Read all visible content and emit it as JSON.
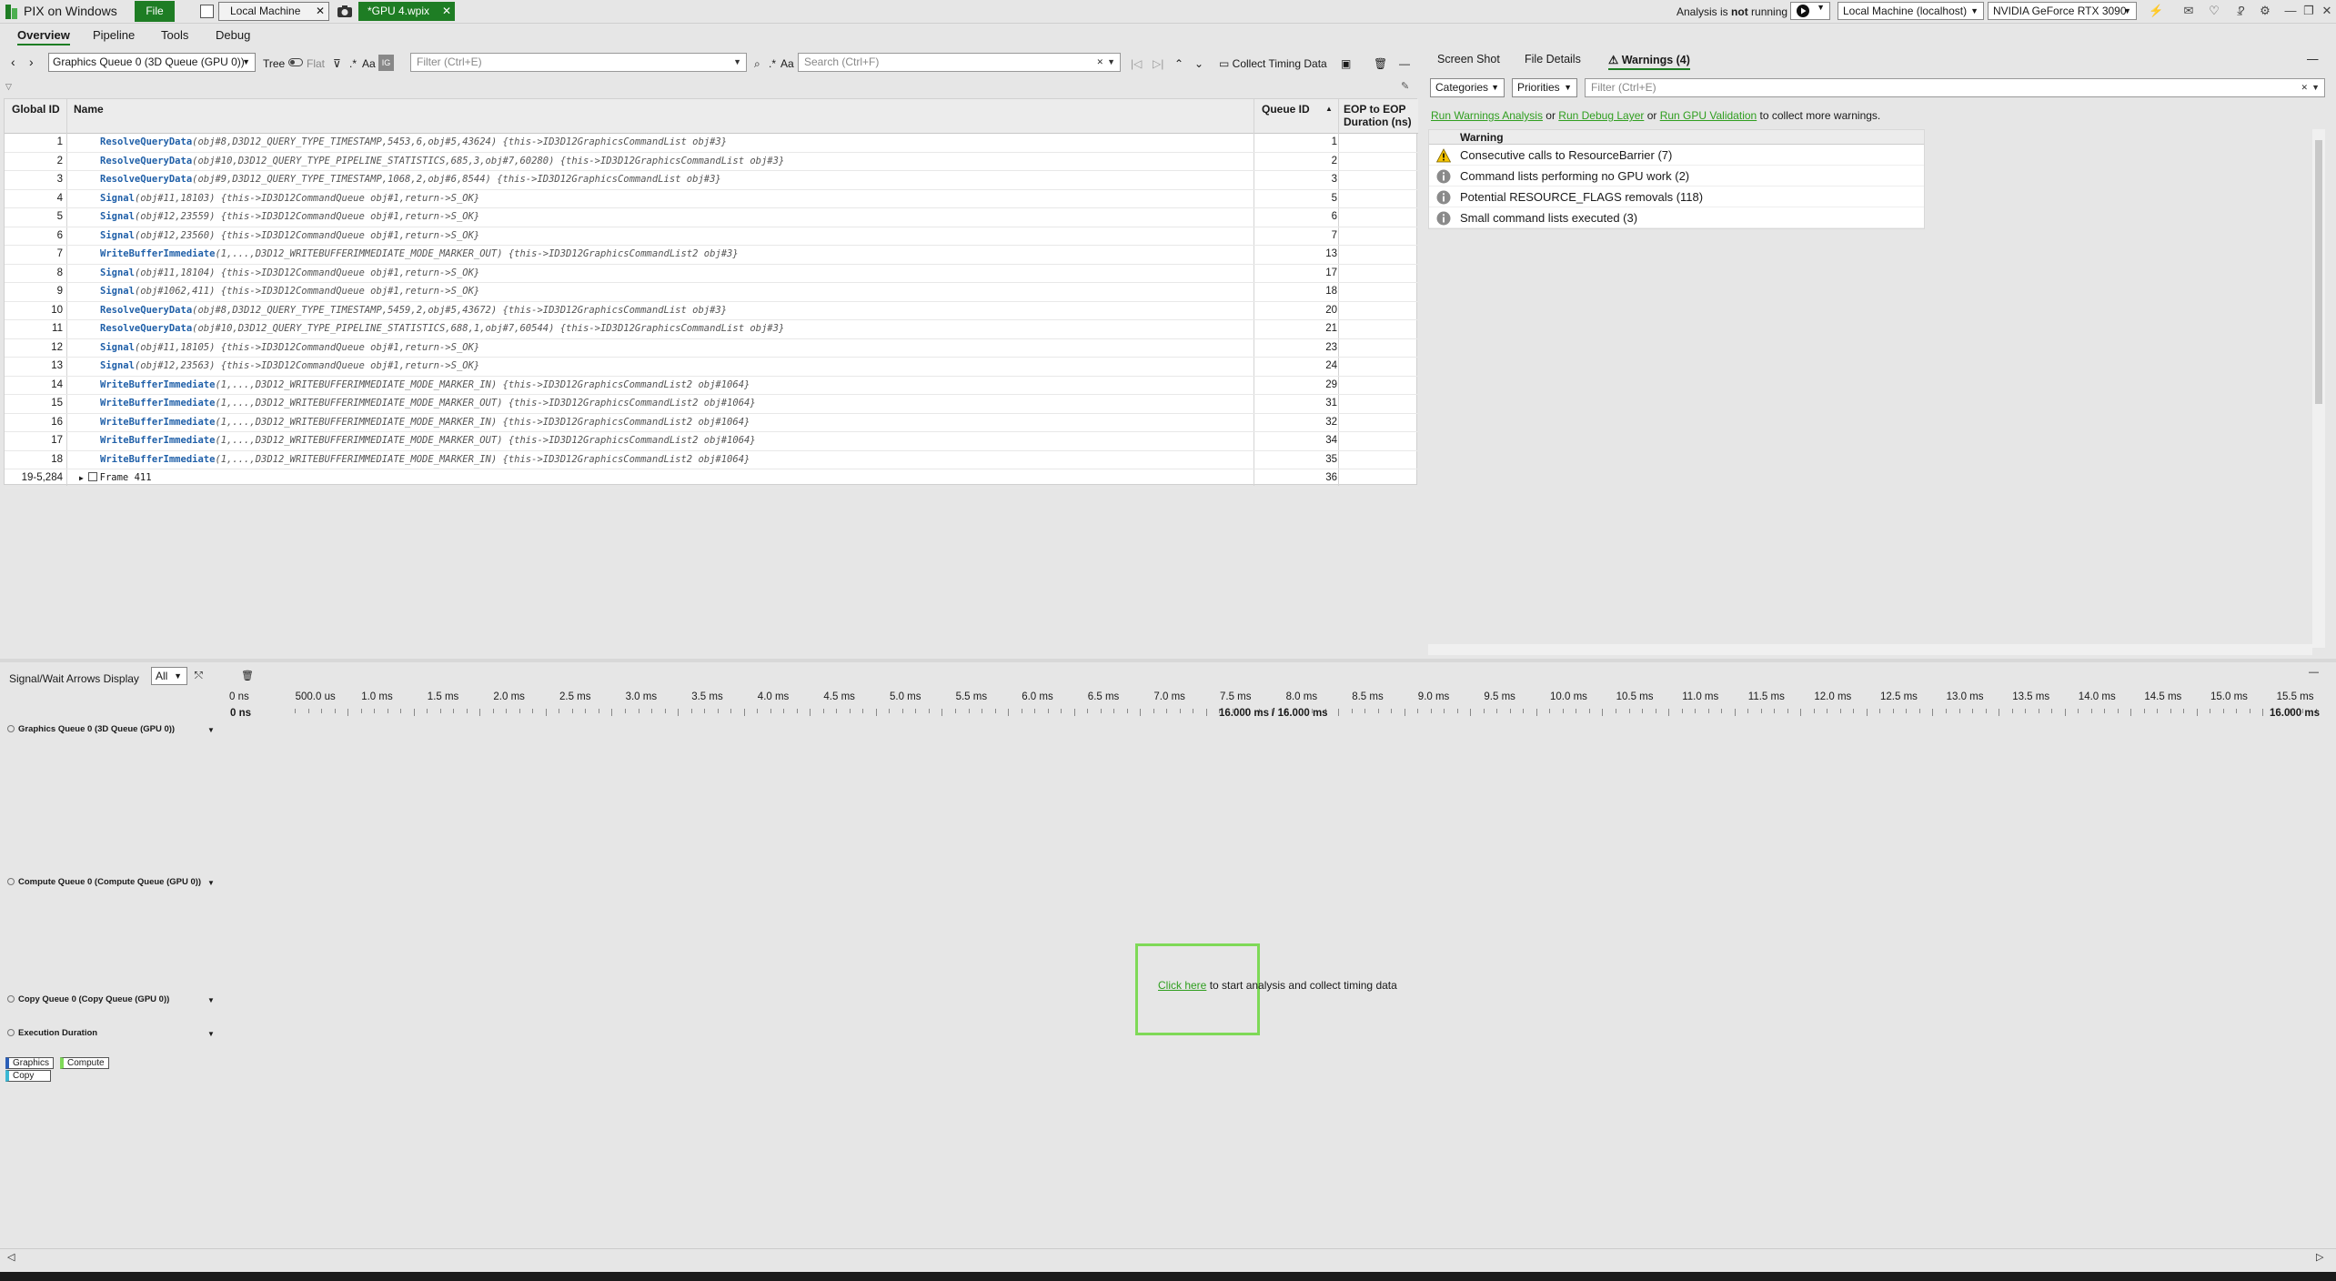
{
  "titlebar": {
    "app_title": "PIX on Windows",
    "file_label": "File",
    "tab_local": "Local Machine",
    "tab_gpu": "*GPU 4.wpix",
    "close_glyph": "✕",
    "analysis_prefix": "Analysis is ",
    "analysis_bold": "not",
    "analysis_suffix": " running",
    "machine": "Local Machine (localhost)",
    "gpu": "NVIDIA GeForce RTX 3090",
    "help": "?"
  },
  "menu": {
    "overview": "Overview",
    "pipeline": "Pipeline",
    "tools": "Tools",
    "debug": "Debug"
  },
  "toolbar": {
    "queue": "Graphics Queue 0 (3D Queue (GPU 0))",
    "tree": "Tree",
    "flat": "Flat",
    "aa": "Aa",
    "filter_placeholder": "Filter (Ctrl+E)",
    "search_placeholder": "Search (Ctrl+F)",
    "collect": "Collect Timing Data"
  },
  "table": {
    "headers": {
      "gid": "Global ID",
      "name": "Name",
      "qid": "Queue ID",
      "eop1": "EOP to EOP",
      "eop2": "Duration (ns)"
    },
    "rows": [
      {
        "gid": "1",
        "fn": "ResolveQueryData",
        "args": "(obj#8,D3D12_QUERY_TYPE_TIMESTAMP,5453,6,obj#5,43624)  {this->ID3D12GraphicsCommandList obj#3}",
        "qid": "1"
      },
      {
        "gid": "2",
        "fn": "ResolveQueryData",
        "args": "(obj#10,D3D12_QUERY_TYPE_PIPELINE_STATISTICS,685,3,obj#7,60280)  {this->ID3D12GraphicsCommandList obj#3}",
        "qid": "2"
      },
      {
        "gid": "3",
        "fn": "ResolveQueryData",
        "args": "(obj#9,D3D12_QUERY_TYPE_TIMESTAMP,1068,2,obj#6,8544)  {this->ID3D12GraphicsCommandList obj#3}",
        "qid": "3"
      },
      {
        "gid": "4",
        "fn": "Signal",
        "args": "(obj#11,18103)  {this->ID3D12CommandQueue obj#1,return->S_OK}",
        "qid": "5"
      },
      {
        "gid": "5",
        "fn": "Signal",
        "args": "(obj#12,23559)  {this->ID3D12CommandQueue obj#1,return->S_OK}",
        "qid": "6"
      },
      {
        "gid": "6",
        "fn": "Signal",
        "args": "(obj#12,23560)  {this->ID3D12CommandQueue obj#1,return->S_OK}",
        "qid": "7"
      },
      {
        "gid": "7",
        "fn": "WriteBufferImmediate",
        "args": "(1,...,D3D12_WRITEBUFFERIMMEDIATE_MODE_MARKER_OUT)  {this->ID3D12GraphicsCommandList2 obj#3}",
        "qid": "13"
      },
      {
        "gid": "8",
        "fn": "Signal",
        "args": "(obj#11,18104)  {this->ID3D12CommandQueue obj#1,return->S_OK}",
        "qid": "17"
      },
      {
        "gid": "9",
        "fn": "Signal",
        "args": "(obj#1062,411)  {this->ID3D12CommandQueue obj#1,return->S_OK}",
        "qid": "18"
      },
      {
        "gid": "10",
        "fn": "ResolveQueryData",
        "args": "(obj#8,D3D12_QUERY_TYPE_TIMESTAMP,5459,2,obj#5,43672)  {this->ID3D12GraphicsCommandList obj#3}",
        "qid": "20"
      },
      {
        "gid": "11",
        "fn": "ResolveQueryData",
        "args": "(obj#10,D3D12_QUERY_TYPE_PIPELINE_STATISTICS,688,1,obj#7,60544)  {this->ID3D12GraphicsCommandList obj#3}",
        "qid": "21"
      },
      {
        "gid": "12",
        "fn": "Signal",
        "args": "(obj#11,18105)  {this->ID3D12CommandQueue obj#1,return->S_OK}",
        "qid": "23"
      },
      {
        "gid": "13",
        "fn": "Signal",
        "args": "(obj#12,23563)  {this->ID3D12CommandQueue obj#1,return->S_OK}",
        "qid": "24"
      },
      {
        "gid": "14",
        "fn": "WriteBufferImmediate",
        "args": "(1,...,D3D12_WRITEBUFFERIMMEDIATE_MODE_MARKER_IN)  {this->ID3D12GraphicsCommandList2 obj#1064}",
        "qid": "29"
      },
      {
        "gid": "15",
        "fn": "WriteBufferImmediate",
        "args": "(1,...,D3D12_WRITEBUFFERIMMEDIATE_MODE_MARKER_OUT)  {this->ID3D12GraphicsCommandList2 obj#1064}",
        "qid": "31"
      },
      {
        "gid": "16",
        "fn": "WriteBufferImmediate",
        "args": "(1,...,D3D12_WRITEBUFFERIMMEDIATE_MODE_MARKER_IN)  {this->ID3D12GraphicsCommandList2 obj#1064}",
        "qid": "32"
      },
      {
        "gid": "17",
        "fn": "WriteBufferImmediate",
        "args": "(1,...,D3D12_WRITEBUFFERIMMEDIATE_MODE_MARKER_OUT)  {this->ID3D12GraphicsCommandList2 obj#1064}",
        "qid": "34"
      },
      {
        "gid": "18",
        "fn": "WriteBufferImmediate",
        "args": "(1,...,D3D12_WRITEBUFFERIMMEDIATE_MODE_MARKER_IN)  {this->ID3D12GraphicsCommandList2 obj#1064}",
        "qid": "35"
      },
      {
        "gid": "19-5,284",
        "fn": "",
        "args": "Frame 411",
        "qid": "36",
        "frame": true
      }
    ]
  },
  "right": {
    "tab_screenshot": "Screen Shot",
    "tab_file_details": "File Details",
    "tab_warnings": "Warnings (4)",
    "categories": "Categories",
    "priorities": "Priorities",
    "filter_placeholder": "Filter (Ctrl+E)",
    "link_warnings": "Run Warnings Analysis",
    "link_debug": "Run Debug Layer",
    "link_gpu": "Run GPU Validation",
    "or1": " or ",
    "or2": " or ",
    "links_suffix": " to collect more warnings.",
    "warn_header": "Warning",
    "warnings": [
      {
        "icon": "warning-icon",
        "text": "Consecutive calls to ResourceBarrier (7)"
      },
      {
        "icon": "info-icon",
        "text": "Command lists performing no GPU work (2)"
      },
      {
        "icon": "info-icon",
        "text": "Potential RESOURCE_FLAGS removals (118)"
      },
      {
        "icon": "info-icon",
        "text": "Small command lists executed (3)"
      }
    ]
  },
  "timeline": {
    "signal_label": "Signal/Wait Arrows Display",
    "signal_value": "All",
    "ticks": [
      "0 ns",
      "500.0 us",
      "1.0 ms",
      "1.5 ms",
      "2.0 ms",
      "2.5 ms",
      "3.0 ms",
      "3.5 ms",
      "4.0 ms",
      "4.5 ms",
      "5.0 ms",
      "5.5 ms",
      "6.0 ms",
      "6.5 ms",
      "7.0 ms",
      "7.5 ms",
      "8.0 ms",
      "8.5 ms",
      "9.0 ms",
      "9.5 ms",
      "10.0 ms",
      "10.5 ms",
      "11.0 ms",
      "11.5 ms",
      "12.0 ms",
      "12.5 ms",
      "13.0 ms",
      "13.5 ms",
      "14.0 ms",
      "14.5 ms",
      "15.0 ms",
      "15.5 ms"
    ],
    "range_start": "0 ns",
    "range_mid": "16.000 ms / 16.000 ms",
    "range_end": "16.000 ms",
    "lanes": {
      "graphics": "Graphics Queue 0 (3D Queue (GPU 0))",
      "compute": "Compute Queue 0 (Compute Queue (GPU 0))",
      "copy": "Copy Queue 0 (Copy Queue (GPU 0))",
      "exec": "Execution Duration"
    },
    "legend": {
      "graphics": "Graphics",
      "compute": "Compute",
      "copy": "Copy"
    },
    "cta_link": "Click here",
    "cta_text": " to start analysis and collect timing data"
  },
  "colors": {
    "accent": "#1e7d24",
    "link": "#2f9e1f",
    "highlight": "#7ed957"
  }
}
